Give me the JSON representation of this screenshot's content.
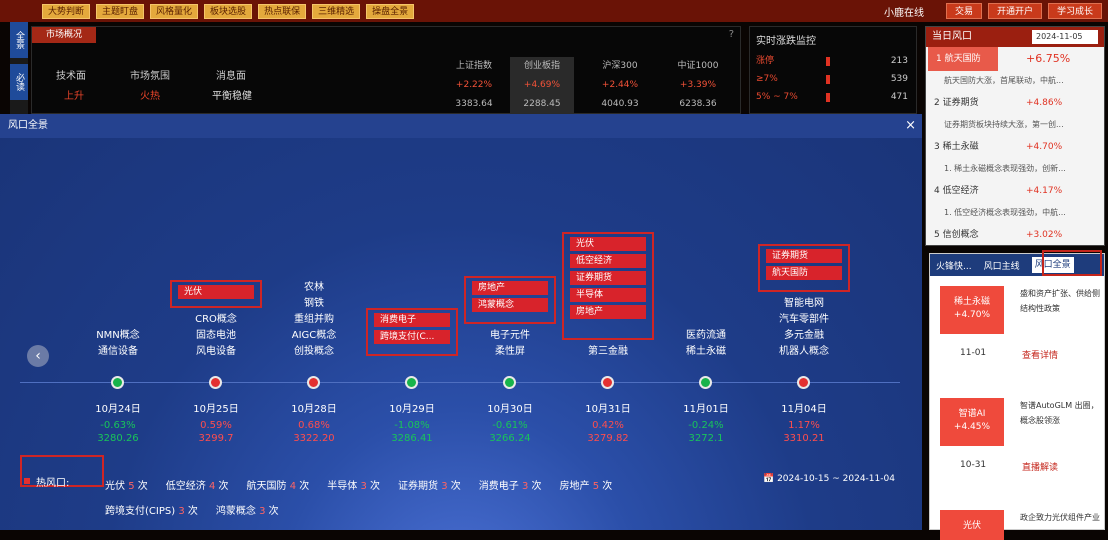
{
  "topbar": {
    "buttons": [
      "大势判断",
      "主题盯盘",
      "风格量化",
      "板块选股",
      "热点联保",
      "三维精选",
      "操盘全景"
    ],
    "right_text": "小鹿在线",
    "right_buttons": [
      "交易",
      "开通开户",
      "学习成长"
    ]
  },
  "lefttabs": [
    "全景",
    "必读"
  ],
  "market": {
    "tab": "市场概况",
    "labels": [
      "技术面",
      "市场氛围",
      "消息面"
    ],
    "values": [
      "上升",
      "火热",
      "平衡稳健"
    ],
    "indices": [
      {
        "name": "上证指数",
        "pct": "+2.22%",
        "val": "3383.64"
      },
      {
        "name": "创业板指",
        "pct": "+4.69%",
        "val": "2288.45"
      },
      {
        "name": "沪深300",
        "pct": "+2.44%",
        "val": "4040.93"
      },
      {
        "name": "中证1000",
        "pct": "+3.39%",
        "val": "6238.36"
      }
    ]
  },
  "monitor": {
    "title": "实时涨跌监控",
    "rows": [
      {
        "label": "涨停",
        "num": "213"
      },
      {
        "label": "≥7%",
        "num": "539"
      },
      {
        "label": "5% ~ 7%",
        "num": "471"
      }
    ]
  },
  "rp": {
    "title": "当日风口",
    "date": "2024-11-05",
    "items": [
      {
        "name": "1 航天国防",
        "pct": "+6.75%",
        "sub": "航天国防大涨，首尾联动，中航..."
      },
      {
        "name": "2 证券期货",
        "pct": "+4.86%",
        "sub": "证券期货板块持续大涨，第一创..."
      },
      {
        "name": "3 稀土永磁",
        "pct": "+4.70%",
        "sub": "1. 稀土永磁概念表现强劲，创新..."
      },
      {
        "name": "4 低空经济",
        "pct": "+4.17%",
        "sub": "1. 低空经济概念表现强劲，中航..."
      },
      {
        "name": "5 信创概念",
        "pct": "+3.02%",
        "sub": ""
      }
    ]
  },
  "rp2": {
    "tabs": [
      "火锋快...",
      "风口主线",
      "风口全景"
    ],
    "cards": [
      {
        "name": "稀土永磁",
        "pct": "+4.70%",
        "date": "11-01",
        "text": "盛和资产扩张、供给侧结构性政策",
        "link": "查看详情"
      },
      {
        "name": "智谱AI",
        "pct": "+4.45%",
        "date": "10-31",
        "text": "智谱AutoGLM 出圈，概念股领涨",
        "link": "直播解读"
      },
      {
        "name": "光伏",
        "pct": "",
        "date": "",
        "text": "政企致力光伏组件产业",
        "link": ""
      }
    ]
  },
  "overlay": {
    "title": "风口全景",
    "close": "×",
    "days": [
      {
        "date": "10月24日",
        "pct": "-0.63%",
        "val": "3280.26",
        "trend": "down",
        "dot": "green",
        "concepts": [
          "NMN概念",
          "通信设备"
        ],
        "hot": []
      },
      {
        "date": "10月25日",
        "pct": "0.59%",
        "val": "3299.7",
        "trend": "up",
        "dot": "red",
        "concepts": [
          "CRO概念",
          "固态电池",
          "风电设备"
        ],
        "hot": [
          "光伏"
        ]
      },
      {
        "date": "10月28日",
        "pct": "0.68%",
        "val": "3322.20",
        "trend": "up",
        "dot": "red",
        "concepts": [
          "农林",
          "钢铁",
          "重组并购",
          "AIGC概念",
          "创投概念"
        ],
        "hot": []
      },
      {
        "date": "10月29日",
        "pct": "-1.08%",
        "val": "3286.41",
        "trend": "down",
        "dot": "green",
        "concepts": [],
        "hot": [
          "消费电子",
          "跨境支付(C..."
        ]
      },
      {
        "date": "10月30日",
        "pct": "-0.61%",
        "val": "3266.24",
        "trend": "down",
        "dot": "green",
        "concepts": [
          "电子元件",
          "柔性屏"
        ],
        "hot": [
          "房地产",
          "鸿蒙概念"
        ]
      },
      {
        "date": "10月31日",
        "pct": "0.42%",
        "val": "3279.82",
        "trend": "up",
        "dot": "red",
        "concepts": [
          "第三金融"
        ],
        "hot": [
          "光伏",
          "低空经济",
          "证券期货",
          "半导体",
          "房地产"
        ]
      },
      {
        "date": "11月01日",
        "pct": "-0.24%",
        "val": "3272.1",
        "trend": "down",
        "dot": "green",
        "concepts": [
          "医药流通",
          "稀土永磁"
        ],
        "hot": []
      },
      {
        "date": "11月04日",
        "pct": "1.17%",
        "val": "3310.21",
        "trend": "up",
        "dot": "red",
        "concepts": [
          "智能电网",
          "汽车零部件",
          "多元金融",
          "机器人概念"
        ],
        "hot": [
          "证券期货",
          "航天国防"
        ]
      }
    ],
    "legend_title": "热风口:",
    "legend": [
      {
        "name": "光伏",
        "n": "5",
        "u": "次"
      },
      {
        "name": "低空经济",
        "n": "4",
        "u": "次"
      },
      {
        "name": "航天国防",
        "n": "4",
        "u": "次"
      },
      {
        "name": "半导体",
        "n": "3",
        "u": "次"
      },
      {
        "name": "证券期货",
        "n": "3",
        "u": "次"
      },
      {
        "name": "消费电子",
        "n": "3",
        "u": "次"
      },
      {
        "name": "房地产",
        "n": "5",
        "u": "次"
      },
      {
        "name": "跨境支付(CIPS)",
        "n": "3",
        "u": "次"
      },
      {
        "name": "鸿蒙概念",
        "n": "3",
        "u": "次"
      }
    ],
    "range": "2024-10-15 ~ 2024-11-04"
  }
}
